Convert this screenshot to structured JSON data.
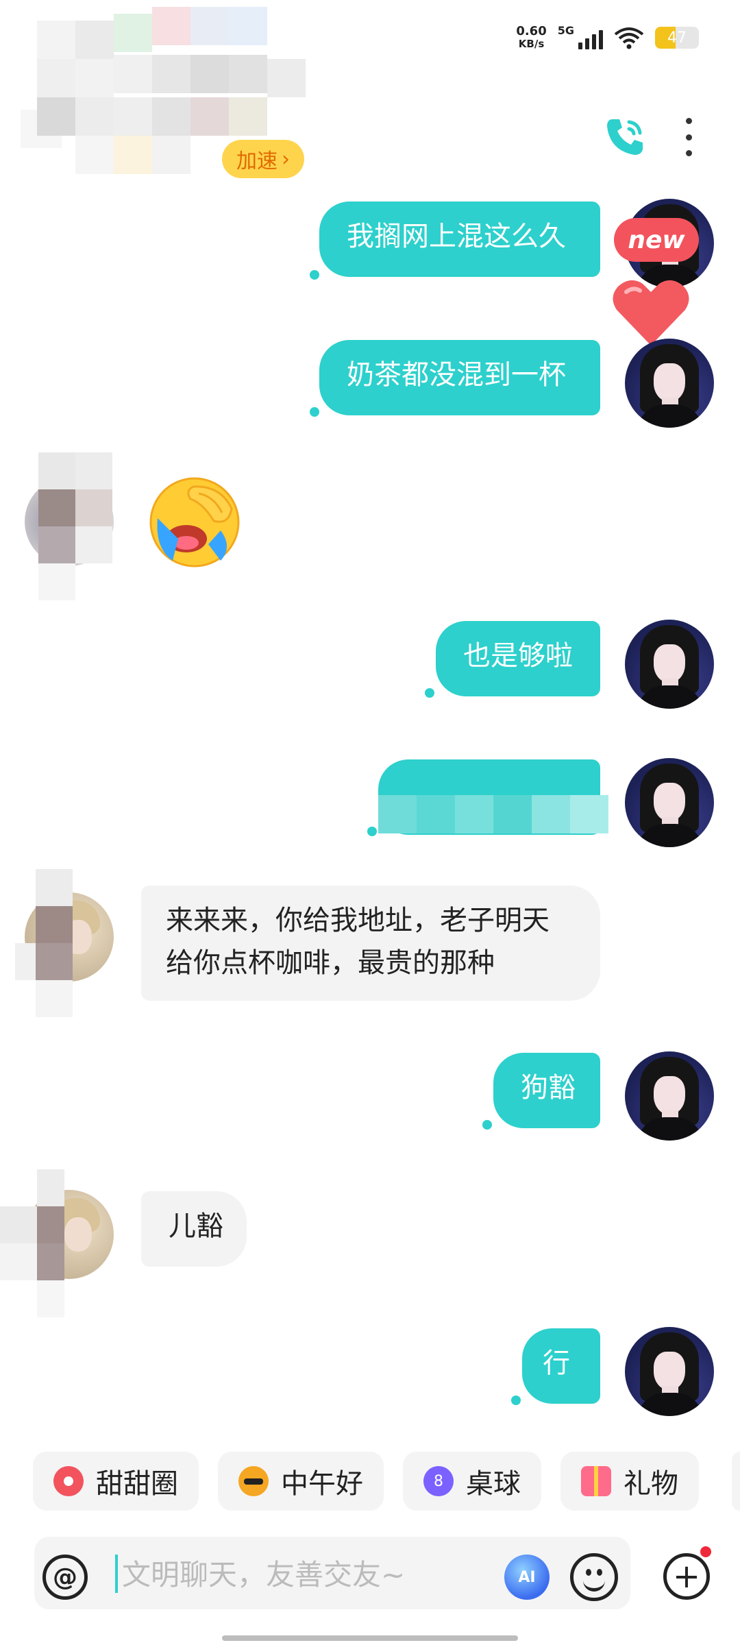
{
  "status_bar": {
    "net_speed": "0.60",
    "net_unit": "KB/s",
    "network": "5G",
    "battery": "47"
  },
  "header": {
    "boost_label": "加速",
    "call_icon": "phone-icon",
    "more_icon": "more-vertical-icon"
  },
  "messages": [
    {
      "side": "out",
      "text": "我搁网上混这么久"
    },
    {
      "side": "out",
      "text": "奶茶都没混到一杯"
    },
    {
      "side": "in",
      "emoji": "crying-face-emoji"
    },
    {
      "side": "out",
      "text": "也是够啦"
    },
    {
      "side": "out",
      "text": ""
    },
    {
      "side": "in",
      "line1": "来来来，你给我地址，老子明天",
      "line2": "给你点杯咖啡，最贵的那种"
    },
    {
      "side": "out",
      "text": "狗豁"
    },
    {
      "side": "in",
      "text": "儿豁"
    },
    {
      "side": "out",
      "text": "行"
    }
  ],
  "badges": {
    "new_label": "new"
  },
  "quick_replies": [
    {
      "label": "甜甜圈",
      "icon": "donut-icon",
      "color": "#f2535d"
    },
    {
      "label": "中午好",
      "icon": "sun-sunglasses-icon",
      "color": "#f5a623"
    },
    {
      "label": "桌球",
      "icon": "billiard-ball-icon",
      "color": "#7b61ff",
      "icon_text": "8"
    },
    {
      "label": "礼物",
      "icon": "gift-icon",
      "color": "#ff6b8a"
    }
  ],
  "input": {
    "placeholder": "文明聊天，友善交友~"
  },
  "colors": {
    "accent": "#2dd0cc",
    "incoming_bubble": "#f3f3f3",
    "new_badge": "#f2535d"
  }
}
